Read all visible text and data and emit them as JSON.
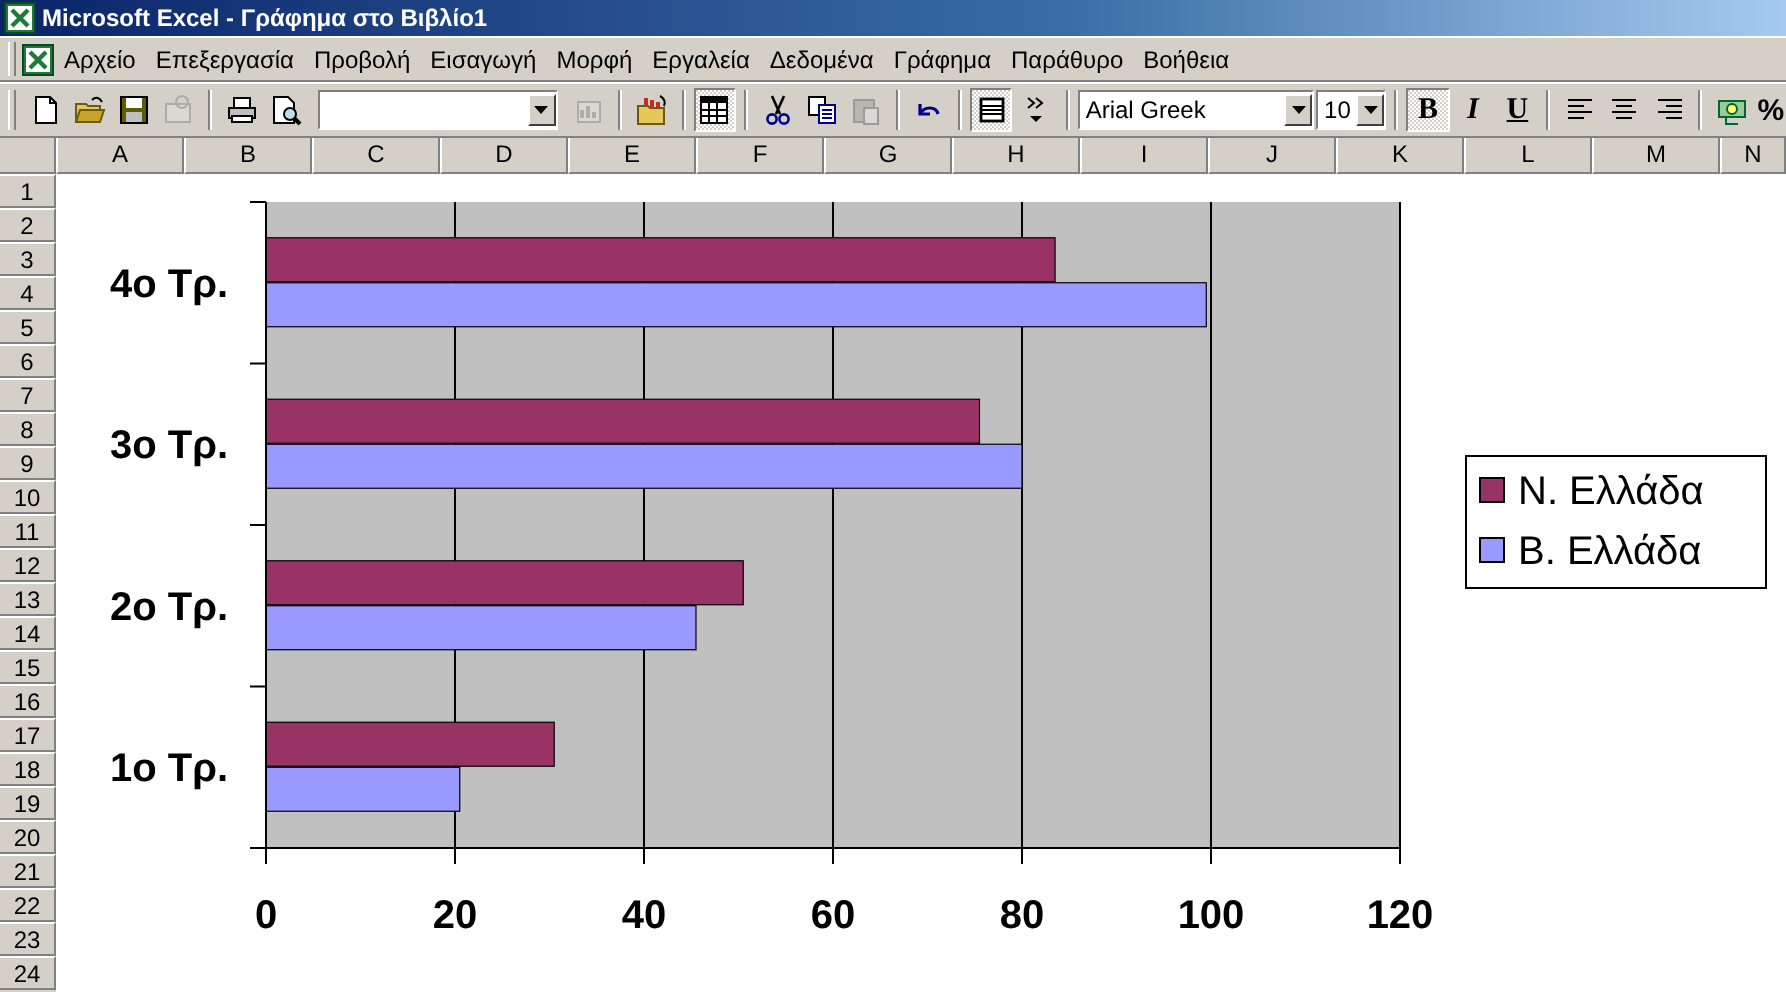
{
  "window": {
    "title": "Microsoft Excel - Γράφημα στο Βιβλίο1"
  },
  "menu_bar": {
    "items": [
      "Αρχείο",
      "Επεξεργασία",
      "Προβολή",
      "Εισαγωγή",
      "Μορφή",
      "Εργαλεία",
      "Δεδομένα",
      "Γράφημα",
      "Παράθυρο",
      "Βοήθεια"
    ]
  },
  "toolbar": {
    "items": [
      {
        "kind": "button",
        "pressed": false,
        "disabled": false
      },
      {
        "kind": "button",
        "pressed": false,
        "disabled": false
      },
      {
        "kind": "button",
        "pressed": false,
        "disabled": false
      },
      {
        "kind": "button",
        "pressed": false,
        "disabled": true
      },
      {
        "kind": "separator"
      },
      {
        "kind": "button",
        "pressed": false,
        "disabled": false
      },
      {
        "kind": "button",
        "pressed": false,
        "disabled": false
      },
      {
        "kind": "combo"
      },
      {
        "kind": "button",
        "pressed": false,
        "disabled": true
      },
      {
        "kind": "separator"
      },
      {
        "kind": "button",
        "pressed": false,
        "disabled": false
      },
      {
        "kind": "separator"
      },
      {
        "kind": "button",
        "pressed": true,
        "disabled": false
      },
      {
        "kind": "separator"
      },
      {
        "kind": "button",
        "pressed": false,
        "disabled": false
      },
      {
        "kind": "button",
        "pressed": false,
        "disabled": false
      },
      {
        "kind": "button",
        "pressed": false,
        "disabled": true
      },
      {
        "kind": "separator"
      },
      {
        "kind": "button",
        "pressed": false,
        "disabled": false
      },
      {
        "kind": "separator"
      },
      {
        "kind": "button",
        "pressed": true,
        "disabled": false
      },
      {
        "kind": "button",
        "pressed": false,
        "disabled": false
      },
      {
        "kind": "separator"
      },
      {
        "kind": "combo",
        "value": "Arial Greek"
      },
      {
        "kind": "combo",
        "value": "10"
      },
      {
        "kind": "separator"
      },
      {
        "kind": "text",
        "label": "B",
        "pressed": true,
        "disabled": false
      },
      {
        "kind": "text",
        "label": "I",
        "pressed": false,
        "disabled": false
      },
      {
        "kind": "text",
        "label": "U",
        "pressed": false,
        "disabled": false
      },
      {
        "kind": "separator"
      },
      {
        "kind": "button",
        "pressed": false,
        "disabled": false
      },
      {
        "kind": "button",
        "pressed": false,
        "disabled": false
      },
      {
        "kind": "button",
        "pressed": false,
        "disabled": false
      },
      {
        "kind": "separator"
      },
      {
        "kind": "button",
        "pressed": false,
        "disabled": false
      },
      {
        "kind": "text",
        "label": "%",
        "pressed": false,
        "disabled": false
      }
    ]
  },
  "sheet": {
    "columns": [
      "A",
      "B",
      "C",
      "D",
      "E",
      "F",
      "G",
      "H",
      "I",
      "J",
      "K",
      "L",
      "M",
      "N"
    ],
    "rows": [
      "1",
      "2",
      "3",
      "4",
      "5",
      "6",
      "7",
      "8",
      "9",
      "10",
      "11",
      "12",
      "13",
      "14",
      "15",
      "16",
      "17",
      "18",
      "19",
      "20",
      "21",
      "22",
      "23",
      "24"
    ],
    "chart_data": {
      "type": "bar",
      "orientation": "horizontal",
      "categories": [
        "4ο Τρ.",
        "3ο Τρ.",
        "2ο Τρ.",
        "1ο Τρ."
      ],
      "series": [
        {
          "name": "Ν. Ελλάδα",
          "color": "#993366",
          "values": [
            83.5,
            75.5,
            50.5,
            30.5
          ]
        },
        {
          "name": "Β. Ελλάδα",
          "color": "#9999ff",
          "values": [
            99.5,
            80,
            45.5,
            20.5
          ]
        }
      ],
      "grid": true,
      "legend": true,
      "xlim": [
        0,
        120
      ],
      "xticks": [
        {
          "value": 0,
          "label": "0"
        },
        {
          "value": 20,
          "label": "20"
        },
        {
          "value": 40,
          "label": "40"
        },
        {
          "value": 60,
          "label": "60"
        },
        {
          "value": 80,
          "label": "80"
        },
        {
          "value": 100,
          "label": "100"
        },
        {
          "value": 120,
          "label": "120"
        }
      ]
    }
  }
}
